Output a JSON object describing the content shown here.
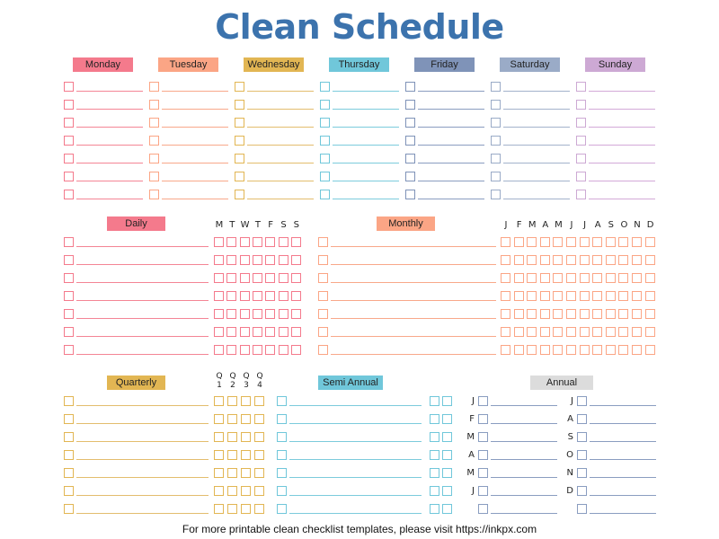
{
  "title": "Clean Schedule",
  "weekdays": [
    {
      "label": "Monday",
      "color": "#f47a8c",
      "line": "#f48595"
    },
    {
      "label": "Tuesday",
      "color": "#fba585",
      "line": "#f8a88a"
    },
    {
      "label": "Wednesday",
      "color": "#e2b653",
      "line": "#e3bd6e"
    },
    {
      "label": "Thursday",
      "color": "#70c7da",
      "line": "#7ccbdc"
    },
    {
      "label": "Friday",
      "color": "#7f93b8",
      "line": "#8a9dc0"
    },
    {
      "label": "Saturday",
      "color": "#9aabc7",
      "line": "#a3b2cb"
    },
    {
      "label": "Sunday",
      "color": "#cda9d4",
      "line": "#d3a9d8"
    }
  ],
  "daily": {
    "label": "Daily",
    "color": "#f47a8c",
    "line": "#f48595",
    "columns": [
      "M",
      "T",
      "W",
      "T",
      "F",
      "S",
      "S"
    ]
  },
  "monthly": {
    "label": "Monthly",
    "color": "#fba585",
    "line": "#f8a88a",
    "columns": [
      "J",
      "F",
      "M",
      "A",
      "M",
      "J",
      "J",
      "A",
      "S",
      "O",
      "N",
      "D"
    ]
  },
  "quarterly": {
    "label": "Quarterly",
    "color": "#e2b653",
    "line": "#e3bd6e",
    "columns": [
      [
        "Q",
        "1"
      ],
      [
        "Q",
        "2"
      ],
      [
        "Q",
        "3"
      ],
      [
        "Q",
        "4"
      ]
    ]
  },
  "semi_annual": {
    "label": "Semi Annual",
    "color": "#70c7da",
    "line": "#7ccbdc"
  },
  "annual": {
    "label": "Annual",
    "color": "#dcdcdc",
    "line": "#8a9dc0",
    "left_months": [
      "J",
      "F",
      "M",
      "A",
      "M",
      "J",
      ""
    ],
    "right_months": [
      "J",
      "A",
      "S",
      "O",
      "N",
      "D",
      ""
    ]
  },
  "footer": "For more printable clean checklist templates, please visit https://inkpx.com"
}
